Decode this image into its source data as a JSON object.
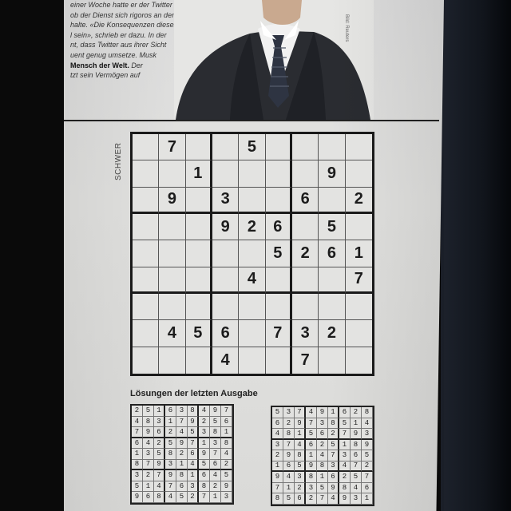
{
  "article": {
    "lines": [
      "einer Woche hatte er der Twitter",
      "ob der Dienst sich rigoros an den",
      "halte. «Die Konsequenzen dieser",
      "l sein», schrieb er dazu. In der",
      "nt, dass Twitter aus ihrer Sicht",
      "uent genug umsetze. Musk"
    ],
    "line_bold_start": "Mensch der Welt.",
    "line_bold_end": " Der",
    "line_last": "tzt sein Vermögen auf",
    "photo_credit": "Bild: Reuters"
  },
  "puzzle": {
    "difficulty": "SCHWER",
    "grid": [
      [
        "",
        "7",
        "",
        "",
        "5",
        "",
        "",
        "",
        ""
      ],
      [
        "",
        "",
        "1",
        "",
        "",
        "",
        "",
        "9",
        ""
      ],
      [
        "",
        "9",
        "",
        "3",
        "",
        "",
        "6",
        "",
        "2"
      ],
      [
        "",
        "",
        "",
        "9",
        "2",
        "6",
        "",
        "5",
        ""
      ],
      [
        "",
        "",
        "",
        "",
        "",
        "5",
        "2",
        "6",
        "1"
      ],
      [
        "",
        "",
        "",
        "",
        "4",
        "",
        "",
        "",
        "7"
      ],
      [
        "",
        "",
        "",
        "",
        "",
        "",
        "",
        "",
        ""
      ],
      [
        "",
        "4",
        "5",
        "6",
        "",
        "7",
        "3",
        "2",
        ""
      ],
      [
        "",
        "",
        "",
        "4",
        "",
        "",
        "7",
        "",
        ""
      ]
    ]
  },
  "solutions": {
    "title": "Lösungen der letzten Ausgabe",
    "left": [
      "251638497",
      "483179256",
      "796245381",
      "642597138",
      "135826974",
      "879314562",
      "327981645",
      "514763829",
      "968452713"
    ],
    "right": [
      "537491628",
      "629738514",
      "481562793",
      "374625189",
      "298147365",
      "165983472",
      "943816257",
      "712359846",
      "856274931"
    ]
  }
}
